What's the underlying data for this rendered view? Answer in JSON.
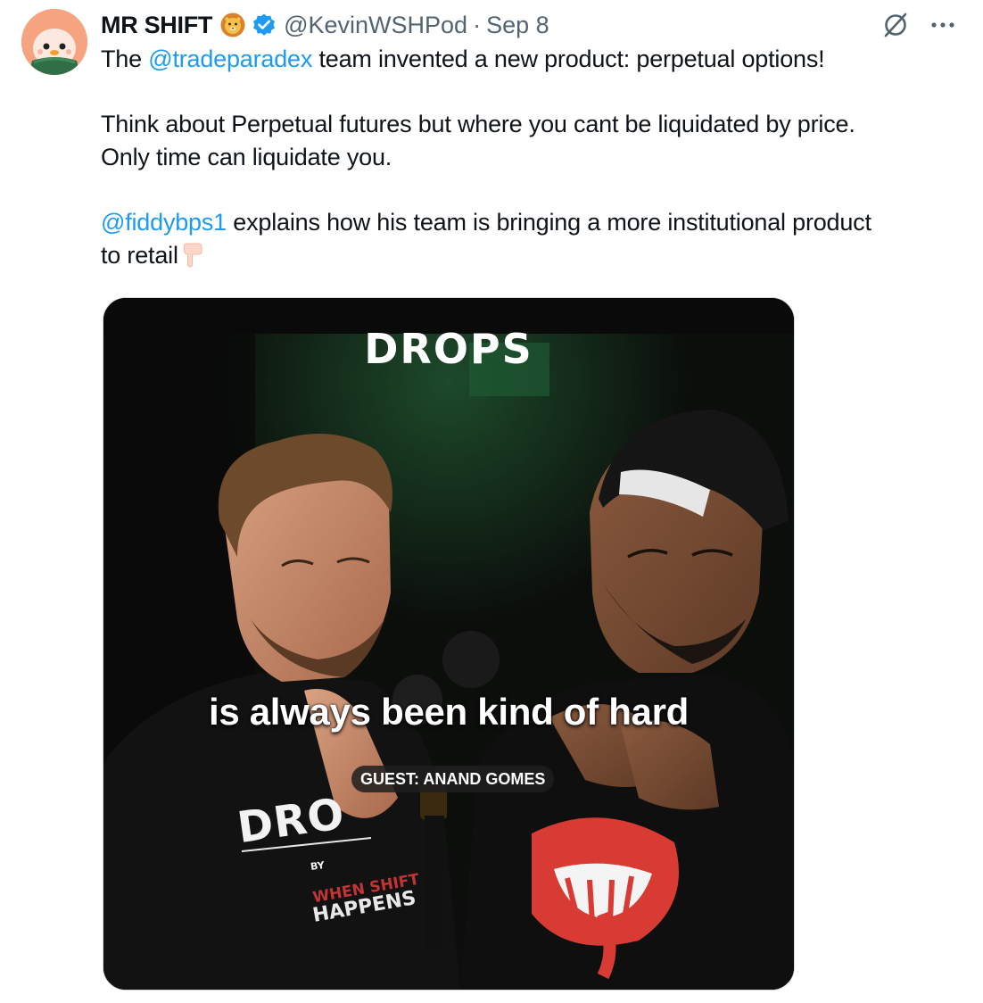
{
  "author": {
    "name": "MR SHIFT",
    "name_emoji": "lion-face-emoji",
    "verified": true,
    "handle": "@KevinWSHPod",
    "separator": "·",
    "date": "Sep 8"
  },
  "actions": {
    "grok_icon": "grok-icon",
    "more_icon": "more-icon"
  },
  "tweet": {
    "line1_pre": "The ",
    "line1_mention": "@tradeparadex",
    "line1_post": " team invented a new product: perpetual options!",
    "para2_line1": "Think about Perpetual futures but where you cant be liquidated by price.",
    "para2_line2": "Only time can liquidate you.",
    "para3_mention": "@fiddybps1",
    "para3_line1_post": " explains how his team is bringing a more institutional product",
    "para3_line2": "to retail",
    "para3_emoji": "pointing-down-hand-emoji"
  },
  "media": {
    "logo": "DROPS",
    "caption": "is always been kind of hard",
    "guest_label": "GUEST: ANAND GOMES",
    "shirt_logo": "DRO",
    "shirt_small": "BY",
    "shirt_shift": "WHEN SHIFT",
    "shirt_happens": "HAPPENS"
  },
  "colors": {
    "link": "#1d9bf0",
    "secondary_text": "#536471",
    "verified_badge": "#1d9bf0"
  }
}
